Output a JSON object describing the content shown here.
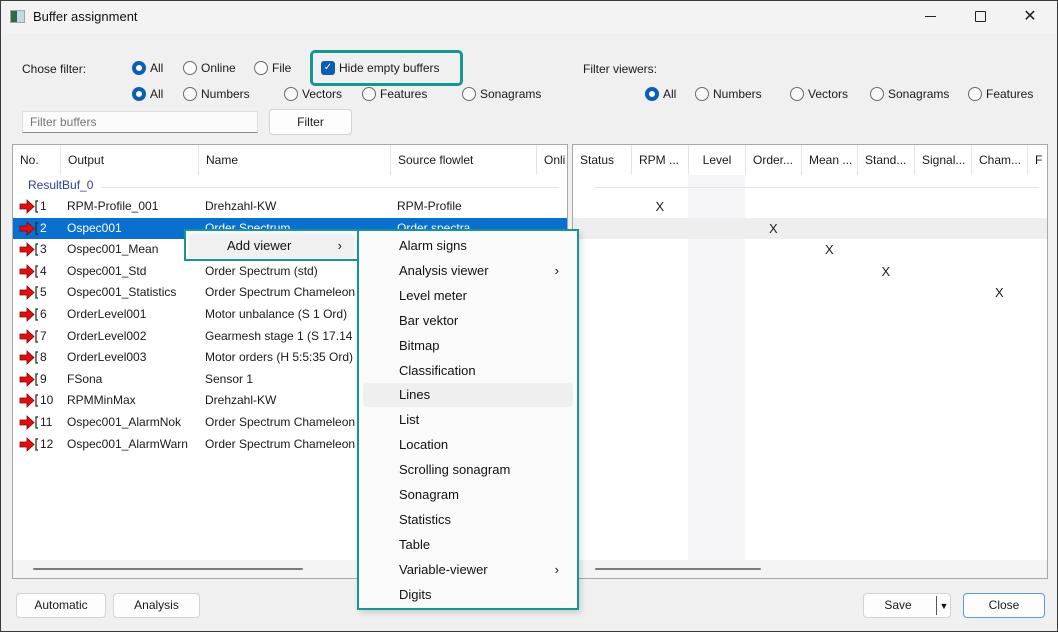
{
  "window": {
    "title": "Buffer assignment",
    "controls": {
      "minimize": "minimize",
      "maximize": "maximize",
      "close": "close"
    }
  },
  "filters": {
    "chose_filter_label": "Chose filter:",
    "source_options": [
      {
        "label": "All",
        "selected": true
      },
      {
        "label": "Online",
        "selected": false
      },
      {
        "label": "File",
        "selected": false
      }
    ],
    "hide_empty_buffers": {
      "label": "Hide empty buffers",
      "checked": true
    },
    "type_options": [
      {
        "label": "All",
        "selected": true
      },
      {
        "label": "Numbers",
        "selected": false
      },
      {
        "label": "Vectors",
        "selected": false
      },
      {
        "label": "Features",
        "selected": false
      },
      {
        "label": "Sonagrams",
        "selected": false
      }
    ],
    "filter_viewers_label": "Filter viewers:",
    "viewer_options": [
      {
        "label": "All",
        "selected": true
      },
      {
        "label": "Numbers",
        "selected": false
      },
      {
        "label": "Vectors",
        "selected": false
      },
      {
        "label": "Sonagrams",
        "selected": false
      },
      {
        "label": "Features",
        "selected": false
      }
    ],
    "search_placeholder": "Filter buffers",
    "search_value": "",
    "filter_button": "Filter"
  },
  "buffers": {
    "columns": [
      "No.",
      "Output",
      "Name",
      "Source flowlet",
      "Onli"
    ],
    "group": "ResultBuf_0",
    "rows": [
      {
        "no": "1",
        "output": "RPM-Profile_001",
        "name": "Drehzahl-KW",
        "source": "RPM-Profile",
        "selected": false
      },
      {
        "no": "2",
        "output": "Ospec001",
        "name": "Order Spectrum",
        "source": "Order spectra",
        "selected": true
      },
      {
        "no": "3",
        "output": "Ospec001_Mean",
        "name": "",
        "source": "",
        "selected": false
      },
      {
        "no": "4",
        "output": "Ospec001_Std",
        "name": "Order Spectrum (std)",
        "source": "",
        "selected": false
      },
      {
        "no": "5",
        "output": "Ospec001_Statistics",
        "name": "Order Spectrum Chameleon",
        "source": "",
        "selected": false
      },
      {
        "no": "6",
        "output": "OrderLevel001",
        "name": "Motor unbalance (S 1 Ord)",
        "source": "",
        "selected": false
      },
      {
        "no": "7",
        "output": "OrderLevel002",
        "name": "Gearmesh stage 1 (S 17.14",
        "source": "",
        "selected": false
      },
      {
        "no": "8",
        "output": "OrderLevel003",
        "name": "Motor orders (H 5:5:35 Ord)",
        "source": "",
        "selected": false
      },
      {
        "no": "9",
        "output": "FSona",
        "name": "Sensor 1",
        "source": "",
        "selected": false
      },
      {
        "no": "10",
        "output": "RPMMinMax",
        "name": "Drehzahl-KW",
        "source": "",
        "selected": false
      },
      {
        "no": "11",
        "output": "Ospec001_AlarmNok",
        "name": "Order Spectrum Chameleon",
        "source": "",
        "selected": false
      },
      {
        "no": "12",
        "output": "Ospec001_AlarmWarn",
        "name": "Order Spectrum Chameleon",
        "source": "",
        "selected": false
      }
    ]
  },
  "viewers": {
    "columns": [
      "Status",
      "RPM ...",
      "Level",
      "Order...",
      "Mean ...",
      "Stand...",
      "Signal...",
      "Cham...",
      "F"
    ],
    "marks": [
      {
        "row": 1,
        "col": 1,
        "text": "X"
      },
      {
        "row": 2,
        "col": 3,
        "text": "X"
      },
      {
        "row": 3,
        "col": 4,
        "text": "X"
      },
      {
        "row": 4,
        "col": 5,
        "text": "X"
      },
      {
        "row": 5,
        "col": 7,
        "text": "X"
      }
    ]
  },
  "context_menu": {
    "item": "Add viewer",
    "submenu": [
      {
        "label": "Alarm signs",
        "has_submenu": false,
        "hover": false
      },
      {
        "label": "Analysis viewer",
        "has_submenu": true,
        "hover": false
      },
      {
        "label": "Level meter",
        "has_submenu": false,
        "hover": false
      },
      {
        "label": "Bar vektor",
        "has_submenu": false,
        "hover": false
      },
      {
        "label": "Bitmap",
        "has_submenu": false,
        "hover": false
      },
      {
        "label": "Classification",
        "has_submenu": false,
        "hover": false
      },
      {
        "label": "Lines",
        "has_submenu": false,
        "hover": true
      },
      {
        "label": "List",
        "has_submenu": false,
        "hover": false
      },
      {
        "label": "Location",
        "has_submenu": false,
        "hover": false
      },
      {
        "label": "Scrolling sonagram",
        "has_submenu": false,
        "hover": false
      },
      {
        "label": "Sonagram",
        "has_submenu": false,
        "hover": false
      },
      {
        "label": "Statistics",
        "has_submenu": false,
        "hover": false
      },
      {
        "label": "Table",
        "has_submenu": false,
        "hover": false
      },
      {
        "label": "Variable-viewer",
        "has_submenu": true,
        "hover": false
      },
      {
        "label": "Digits",
        "has_submenu": false,
        "hover": false
      }
    ]
  },
  "footer": {
    "automatic": "Automatic",
    "analysis": "Analysis",
    "save": "Save",
    "close": "Close"
  },
  "colors": {
    "accent": "#0a5fb4",
    "selection": "#0a70d0",
    "highlight_frame": "#17968f",
    "group_label": "#2d3fa0",
    "arrow_icon": "#e01010"
  }
}
